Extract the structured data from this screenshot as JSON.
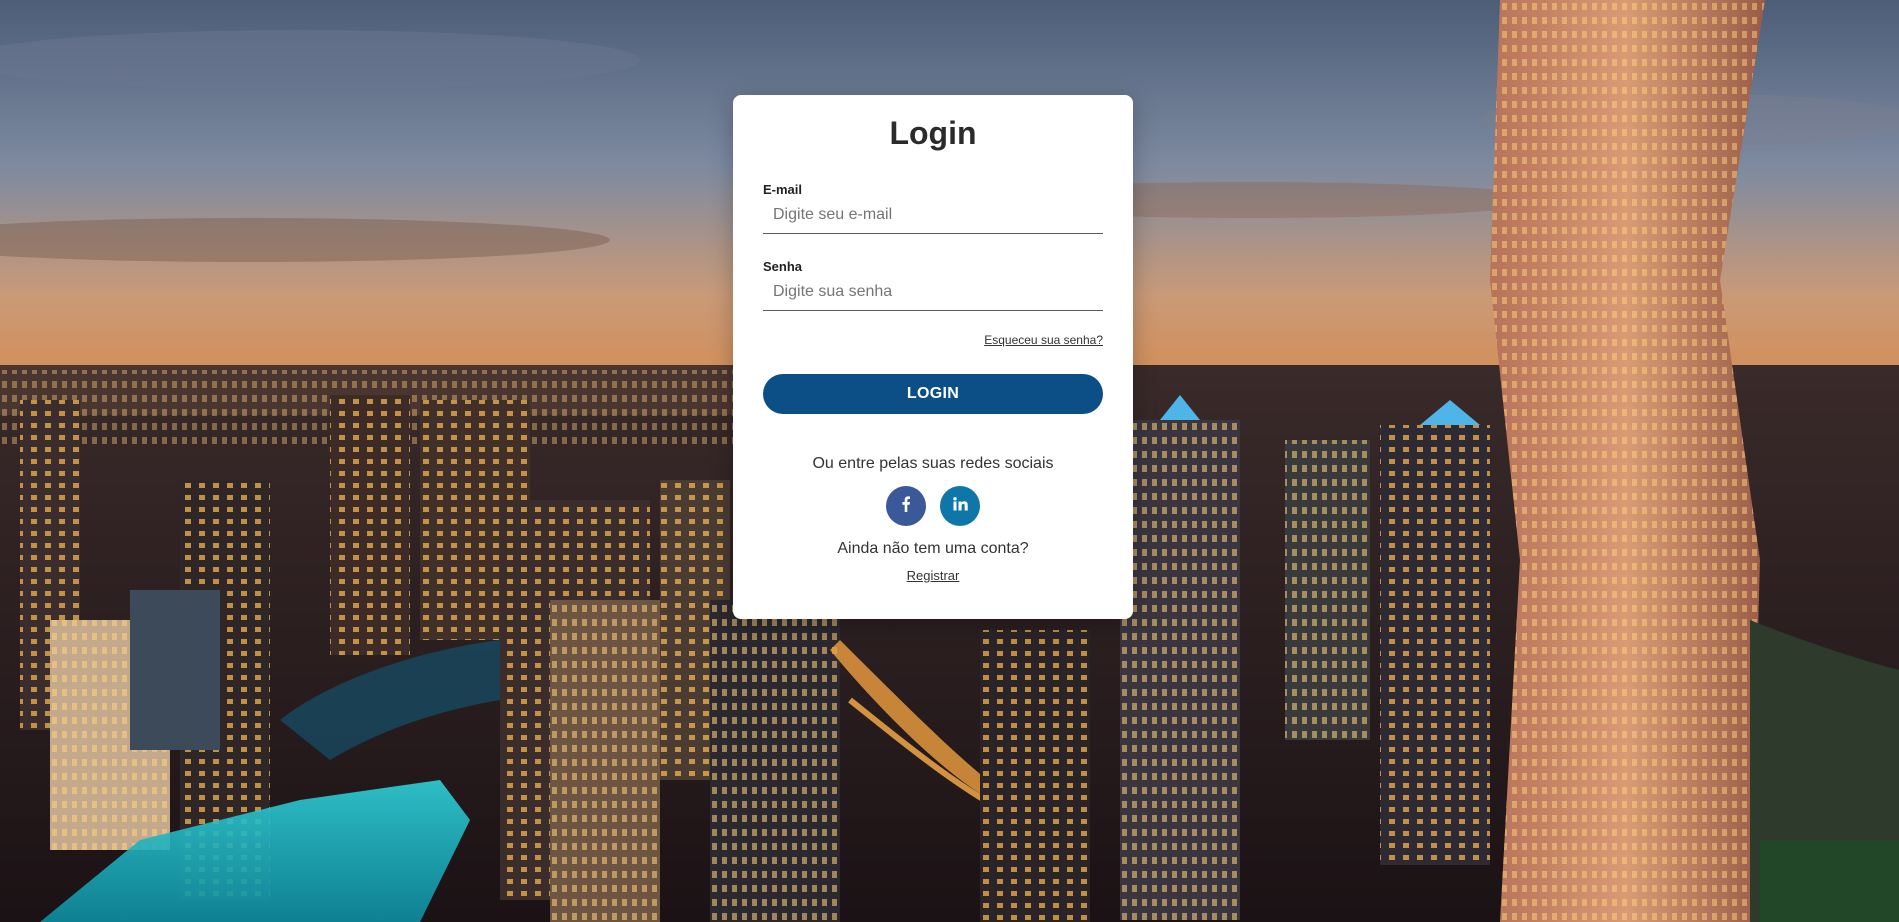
{
  "login": {
    "title": "Login",
    "email_label": "E-mail",
    "email_placeholder": "Digite seu e-mail",
    "email_value": "",
    "password_label": "Senha",
    "password_placeholder": "Digite sua senha",
    "password_value": "",
    "forgot_link": "Esqueceu sua senha?",
    "submit_label": "LOGIN",
    "social_text": "Ou entre pelas suas redes sociais",
    "social": [
      {
        "icon": "facebook-icon",
        "glyph": "f"
      },
      {
        "icon": "linkedin-icon",
        "glyph": "in"
      }
    ],
    "signup_text": "Ainda não tem uma conta?",
    "register_link": "Registrar"
  },
  "colors": {
    "primary_button": "#0b4f86",
    "facebook": "#3b5998",
    "linkedin": "#0e76a8",
    "card_background": "#ffffff"
  }
}
